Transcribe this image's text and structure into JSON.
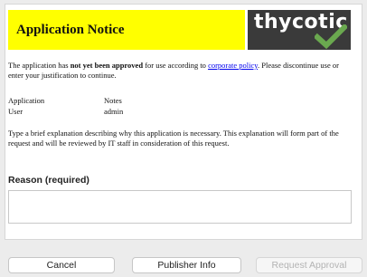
{
  "notice": {
    "title": "Application Notice",
    "logo_text": "thycotic",
    "banner_color": "#ffff00",
    "logo_bg": "#3a3a3a",
    "check_color": "#6aa84f",
    "intro_before": "The application has ",
    "intro_bold": "not yet been approved",
    "intro_middle": " for use according to ",
    "intro_link": "corporate policy",
    "intro_after": ". Please discontinue use or enter your justification to continue.",
    "info": [
      {
        "label": "Application",
        "value": "Notes"
      },
      {
        "label": "User",
        "value": "admin"
      }
    ],
    "explanation": "Type a brief explanation describing why this application is necessary. This explanation will form part of the request and will be reviewed by IT staff in consideration of this request."
  },
  "form": {
    "reason_label": "Reason (required)",
    "reason_value": ""
  },
  "buttons": {
    "cancel": "Cancel",
    "publisher_info": "Publisher Info",
    "request_approval": "Request Approval"
  }
}
